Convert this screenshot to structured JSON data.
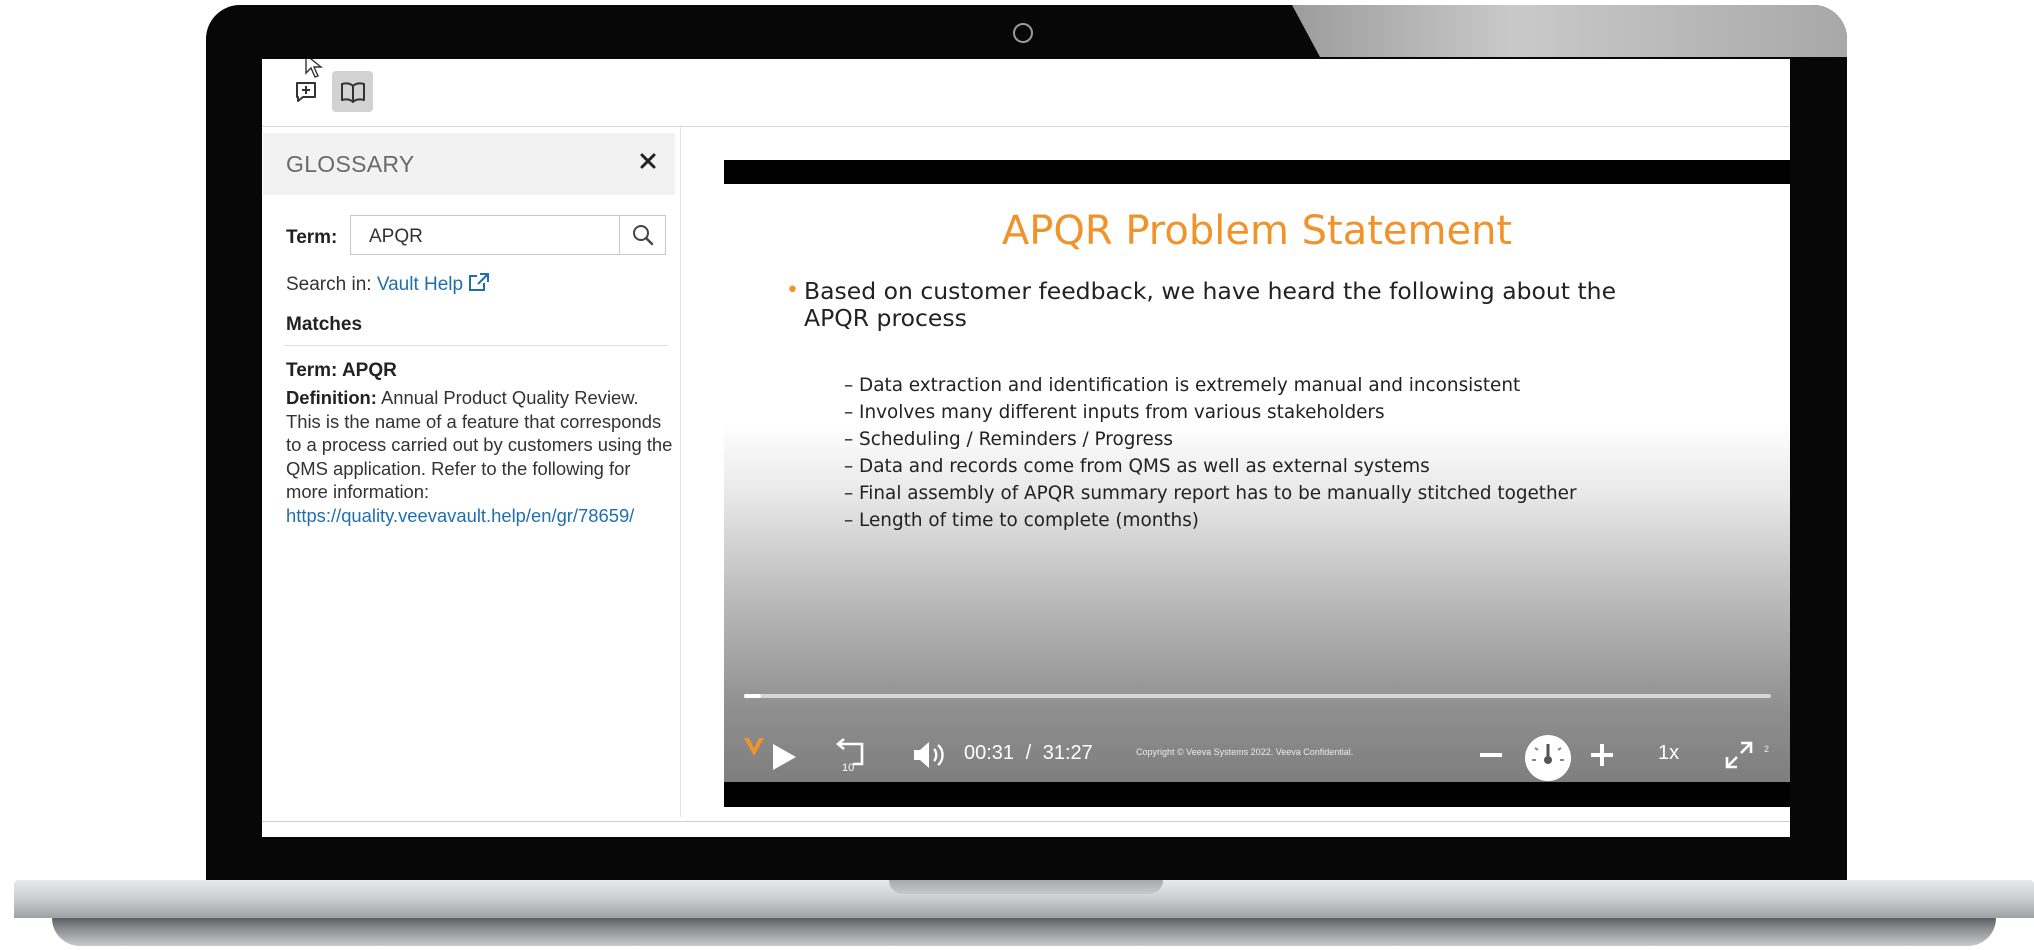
{
  "glossary": {
    "title": "GLOSSARY",
    "term_label": "Term:",
    "term_value": "APQR",
    "search_in_label": "Search in:",
    "search_in_link": "Vault Help",
    "matches_label": "Matches",
    "result": {
      "term_line": "Term: APQR",
      "definition_label": "Definition:",
      "definition_text": "Annual Product Quality Review. This is the name of a feature that corresponds to a process carried out by customers using the QMS application. Refer to the following for more information:",
      "definition_link": "https://quality.veevavault.help/en/gr/78659/"
    }
  },
  "slide": {
    "title": "APQR Problem Statement",
    "bullet": "Based on customer feedback, we have heard the following about the APQR process",
    "sub_bullets": [
      "Data extraction and identification is extremely manual and inconsistent",
      "Involves many different inputs from various stakeholders",
      "Scheduling / Reminders / Progress",
      "Data and records come from QMS as well as external systems",
      "Final assembly of APQR summary report has to be manually stitched together",
      "Length of time to complete (months)"
    ],
    "copyright": "Copyright © Veeva Systems 2022. Veeva Confidential.",
    "page_number": "2"
  },
  "player": {
    "current_time": "00:31",
    "separator": "/",
    "duration": "31:27",
    "speed": "1x",
    "progress_fraction": 0.017,
    "rewind_seconds": "10"
  },
  "colors": {
    "accent_orange": "#f0932b",
    "link_blue": "#1f6fb0",
    "player_bg": "#000000"
  },
  "icons": {
    "toolbar": [
      "add-comment-icon",
      "glossary-book-icon"
    ],
    "panel": [
      "close-icon",
      "search-icon",
      "external-link-icon"
    ],
    "player": [
      "veeva-logo-icon",
      "play-icon",
      "rewind-10-icon",
      "volume-icon",
      "zoom-out-icon",
      "speedometer-icon",
      "zoom-in-icon",
      "fullscreen-icon"
    ]
  }
}
